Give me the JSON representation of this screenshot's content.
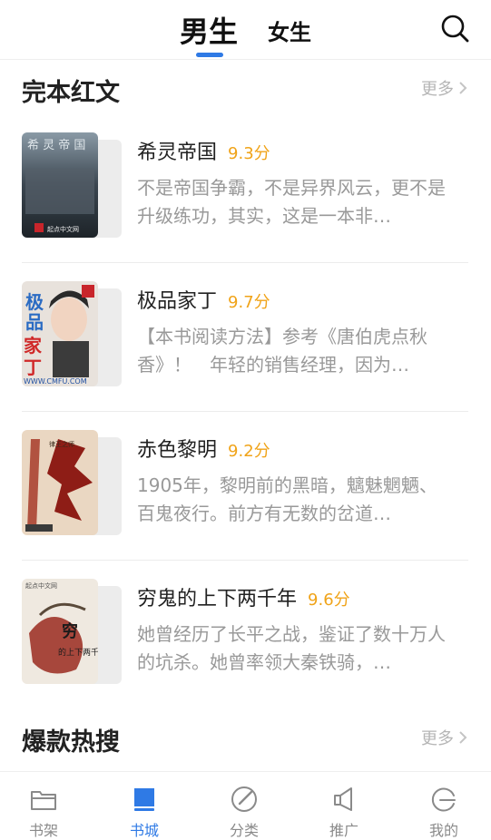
{
  "header": {
    "tabs": [
      {
        "label": "男生",
        "active": true
      },
      {
        "label": "女生",
        "active": false
      }
    ],
    "search_icon": "search-icon",
    "accent_color": "#2f7ae5"
  },
  "sections": [
    {
      "title": "完本红文",
      "more_label": "更多",
      "books": [
        {
          "title": "希灵帝国",
          "score": "9.3分",
          "desc": "不是帝国争霸，不是异界风云，更不是升级练功，其实，这是一本非…"
        },
        {
          "title": "极品家丁",
          "score": "9.7分",
          "desc": "【本书阅读方法】参考《唐伯虎点秋香》！　年轻的销售经理，因为…"
        },
        {
          "title": "赤色黎明",
          "score": "9.2分",
          "desc": "1905年，黎明前的黑暗，魑魅魍魉、百鬼夜行。前方有无数的岔道…"
        },
        {
          "title": "穷鬼的上下两千年",
          "score": "9.6分",
          "desc": "她曾经历了长平之战，鉴证了数十万人的坑杀。她曾率领大秦铁骑，…"
        }
      ]
    },
    {
      "title": "爆款热搜",
      "more_label": "更多"
    }
  ],
  "bottom_nav": [
    {
      "label": "书架",
      "icon": "bookshelf-icon",
      "active": false
    },
    {
      "label": "书城",
      "icon": "bookstore-icon",
      "active": true
    },
    {
      "label": "分类",
      "icon": "category-icon",
      "active": false
    },
    {
      "label": "推广",
      "icon": "promote-icon",
      "active": false
    },
    {
      "label": "我的",
      "icon": "profile-icon",
      "active": false
    }
  ],
  "score_color": "#f0a318"
}
